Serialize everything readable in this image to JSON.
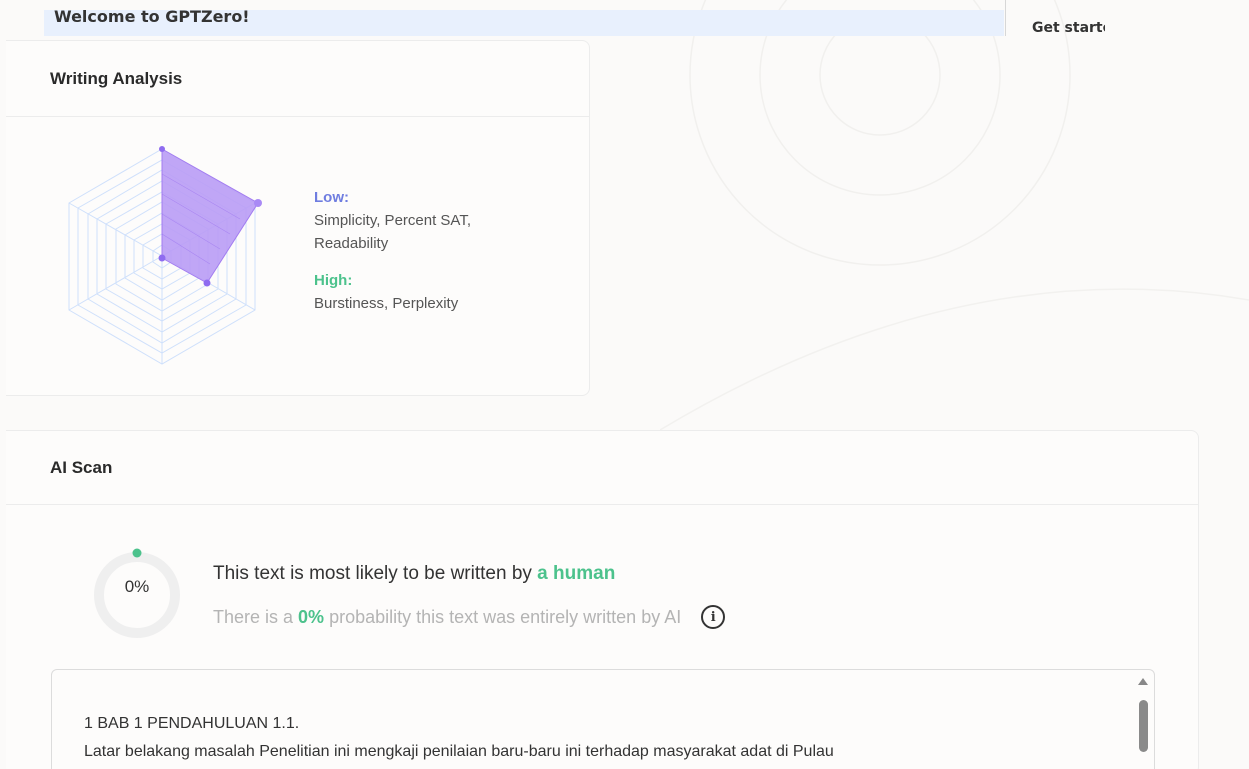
{
  "banner": {
    "welcome": "Welcome to GPTZero!",
    "get_started": "Get started"
  },
  "writing_analysis": {
    "title": "Writing Analysis",
    "low_label": "Low:",
    "low_items": "Simplicity, Percent SAT, Readability",
    "high_label": "High:",
    "high_items": "Burstiness, Perplexity",
    "radar": {
      "axes": [
        "Simplicity",
        "Percent SAT",
        "Readability",
        "Burstiness",
        "Perplexity"
      ],
      "values_note": "",
      "fill_color": "#b99cf5",
      "grid_color": "#cfe0fb"
    }
  },
  "ai_scan": {
    "title": "AI Scan",
    "score_display": "0%",
    "score_fraction": 0.0,
    "result_prefix": "This text is most likely to be written by ",
    "result_highlight": "a human",
    "prob_prefix": "There is a ",
    "prob_value": "0%",
    "prob_suffix": " probability this text was entirely written by AI",
    "info_icon": "i",
    "text_line1": "1 BAB 1 PENDAHULUAN 1.1.",
    "text_line2": "Latar belakang masalah Penelitian ini mengkaji penilaian baru-baru ini terhadap masyarakat adat di Pulau"
  },
  "colors": {
    "accent_green": "#4cc28c",
    "accent_blue": "#6f7de0",
    "radar_fill": "#b99cf5"
  },
  "icons": {
    "info": "info-circle-icon",
    "scroll_up": "triangle-up-icon"
  }
}
